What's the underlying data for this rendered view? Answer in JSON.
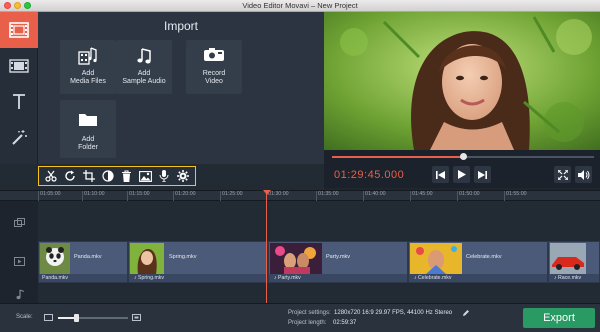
{
  "window": {
    "title": "Video Editor Movavi – New Project"
  },
  "sidebar": {
    "items": [
      {
        "name": "import",
        "icon": "film-import-icon",
        "active": true
      },
      {
        "name": "filters",
        "icon": "filmstrip-icon"
      },
      {
        "name": "titles",
        "icon": "text-icon"
      },
      {
        "name": "transitions",
        "icon": "magic-wand-icon"
      },
      {
        "name": "more",
        "icon": "menu-icon"
      }
    ]
  },
  "import": {
    "title": "Import",
    "tiles": [
      {
        "label": "Add\nMedia Files",
        "icon": "media-files-icon"
      },
      {
        "label": "Add\nSample Audio",
        "icon": "music-note-icon"
      },
      {
        "label": "Record\nVideo",
        "icon": "webcam-icon"
      },
      {
        "label": "Add\nFolder",
        "icon": "folder-icon"
      }
    ]
  },
  "player": {
    "timecode": "01:29:45.000",
    "progress": 0.5
  },
  "toolbar": {
    "tools": [
      "cut-icon",
      "rotate-icon",
      "crop-icon",
      "color-adjust-icon",
      "delete-icon",
      "image-icon",
      "microphone-icon",
      "settings-icon"
    ]
  },
  "timeline": {
    "ticks": [
      "01:05:00",
      "01:10:00",
      "01:15:00",
      "01:20:00",
      "01:25:00",
      "01:30:00",
      "01:35:00",
      "01:40:00",
      "01:45:00",
      "01:50:00",
      "01:55:00"
    ],
    "clips": [
      {
        "name": "Panda.mkv",
        "audio": "Panda.mkv"
      },
      {
        "name": "Spring.mkv",
        "audio": "Spring.mkv"
      },
      {
        "name": "Party.mkv",
        "audio": "Party.mkv"
      },
      {
        "name": "Celebrate.mkv",
        "audio": "Celebrate.mkv"
      },
      {
        "name": "Race.mkv",
        "audio": "Race.mkv"
      }
    ]
  },
  "bottom": {
    "scale_label": "Scale:",
    "scale_value": 0.25,
    "settings_label": "Project settings:",
    "settings_value": "1280x720 16:9 29.97 FPS, 44100 Hz Stereo",
    "length_label": "Project length:",
    "length_value": "02:59:37",
    "export_label": "Export"
  },
  "colors": {
    "accent": "#e8604a",
    "export": "#2a9a64",
    "highlight": "#f3c21c"
  }
}
